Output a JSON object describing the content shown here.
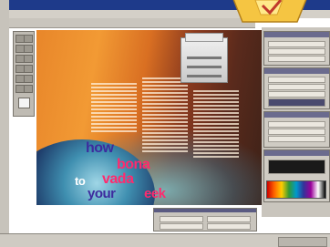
{
  "window": {
    "title": ""
  },
  "menubar": {
    "items": [
      "",
      "",
      "",
      "",
      "",
      "",
      ""
    ]
  },
  "document": {
    "headline": {
      "word1": "how",
      "word2": "bona",
      "word3": "to",
      "word4": "vada",
      "word5": "your",
      "word6": "eek"
    }
  },
  "statusbar": {
    "text": ""
  },
  "colors": {
    "headline_purple": "#3d2b9e",
    "headline_pink": "#ff2a6e",
    "titlebar": "#1e3a8a",
    "badge": "#f5c542"
  },
  "icons": [
    "toolbox-tools",
    "printer-image",
    "badge-graphic"
  ]
}
